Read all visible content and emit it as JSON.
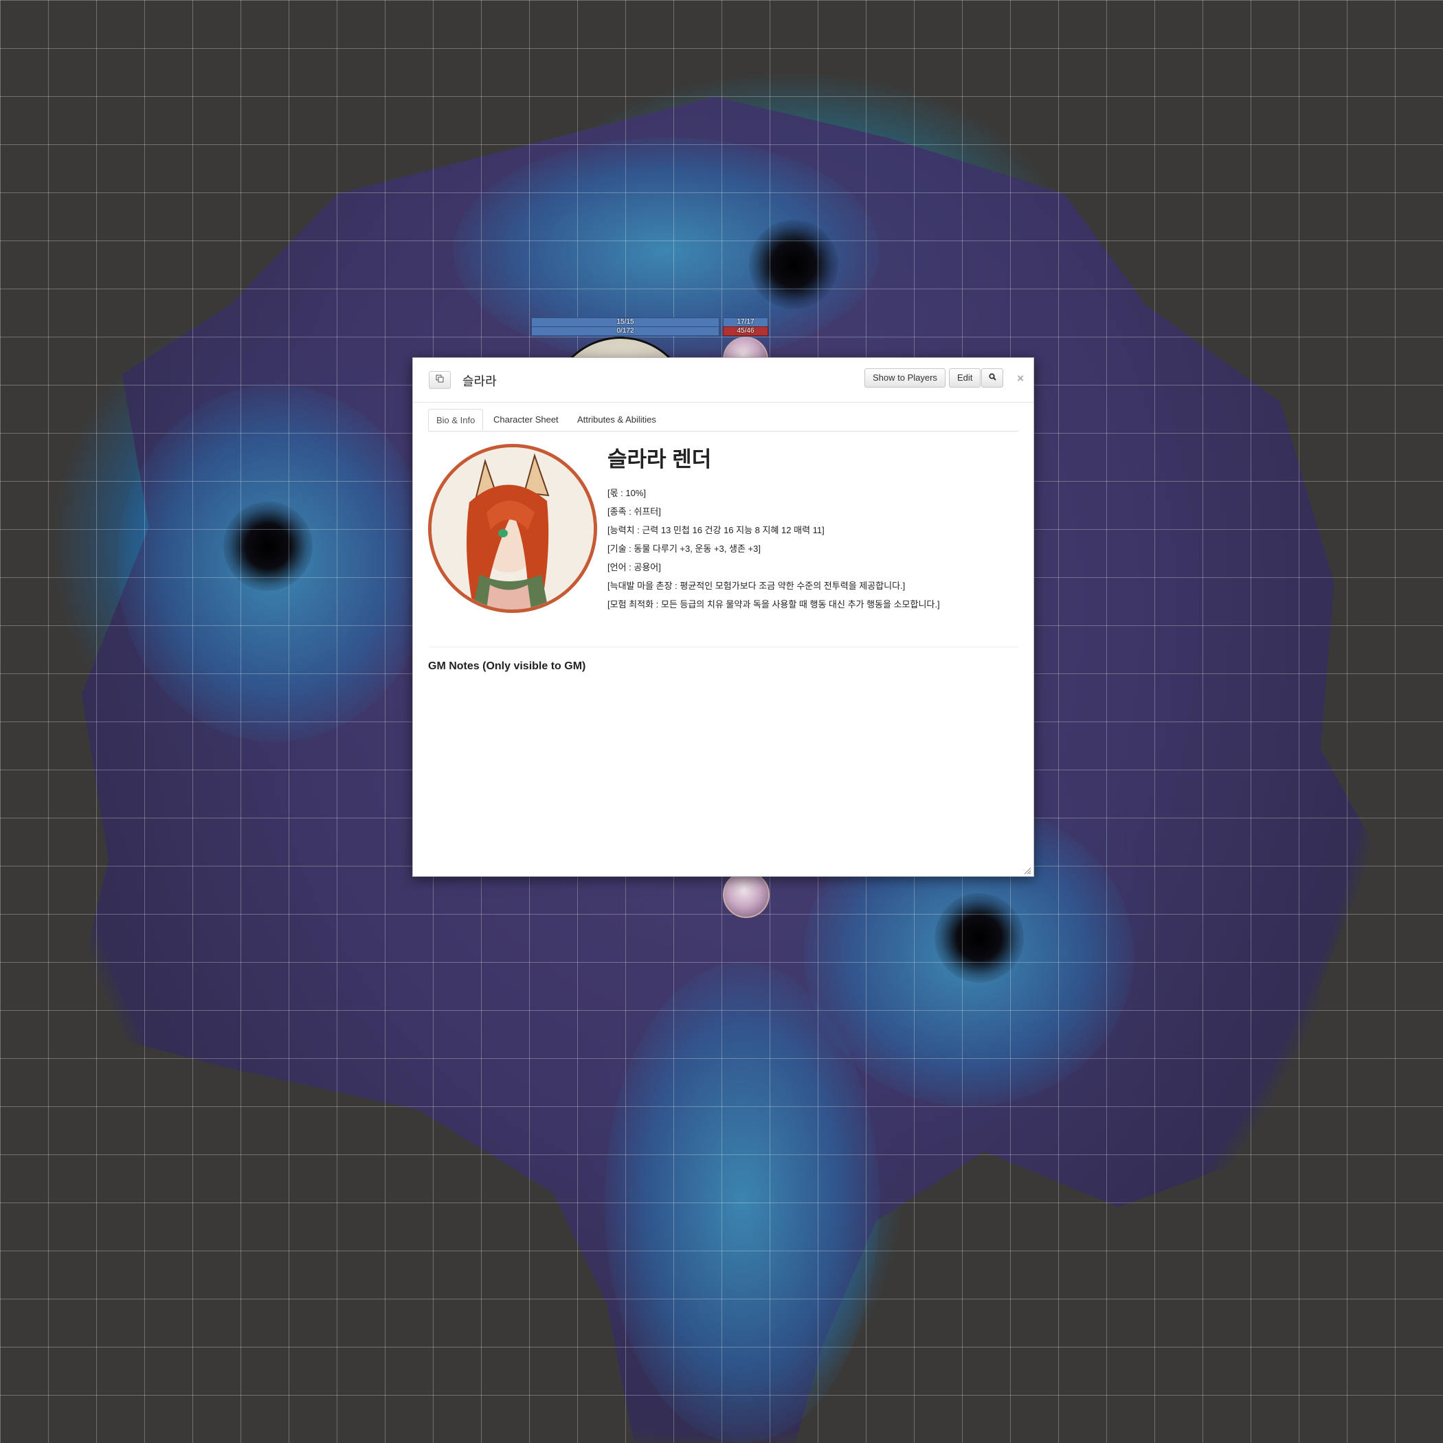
{
  "map": {
    "token_bars": {
      "left_top": "15/15",
      "left_bottom": "0/172",
      "right_top": "17/17",
      "right_bottom": "45/46"
    }
  },
  "dialog": {
    "title": "슬라라",
    "buttons": {
      "show_to_players": "Show to Players",
      "edit": "Edit",
      "close": "×"
    },
    "tabs": [
      "Bio & Info",
      "Character Sheet",
      "Attributes & Abilities"
    ],
    "active_tab": "Bio & Info",
    "bio": {
      "name": "슬라라 렌더",
      "lines": [
        "[몫 : 10%]",
        "[종족 : 쉬프터]",
        "[능력치 : 근력 13 민첩 16 건강 16 지능 8 지혜 12 매력 11]",
        "[기술 : 동물 다루기 +3, 운동 +3, 생존 +3]",
        "[언어 : 공용어]",
        "[늑대발 마을 촌장 : 평균적인 모험가보다 조금 약한 수준의 전투력을 제공합니다.]",
        "[모험 최적화 : 모든 등급의 치유 물약과 독을 사용할 때 행동 대신 추가 행동을 소모합니다.]"
      ]
    },
    "gm_notes_label": "GM Notes (Only visible to GM)"
  },
  "icons": [
    "popout-icon",
    "search-icon",
    "close-icon",
    "resize-handle-icon"
  ]
}
